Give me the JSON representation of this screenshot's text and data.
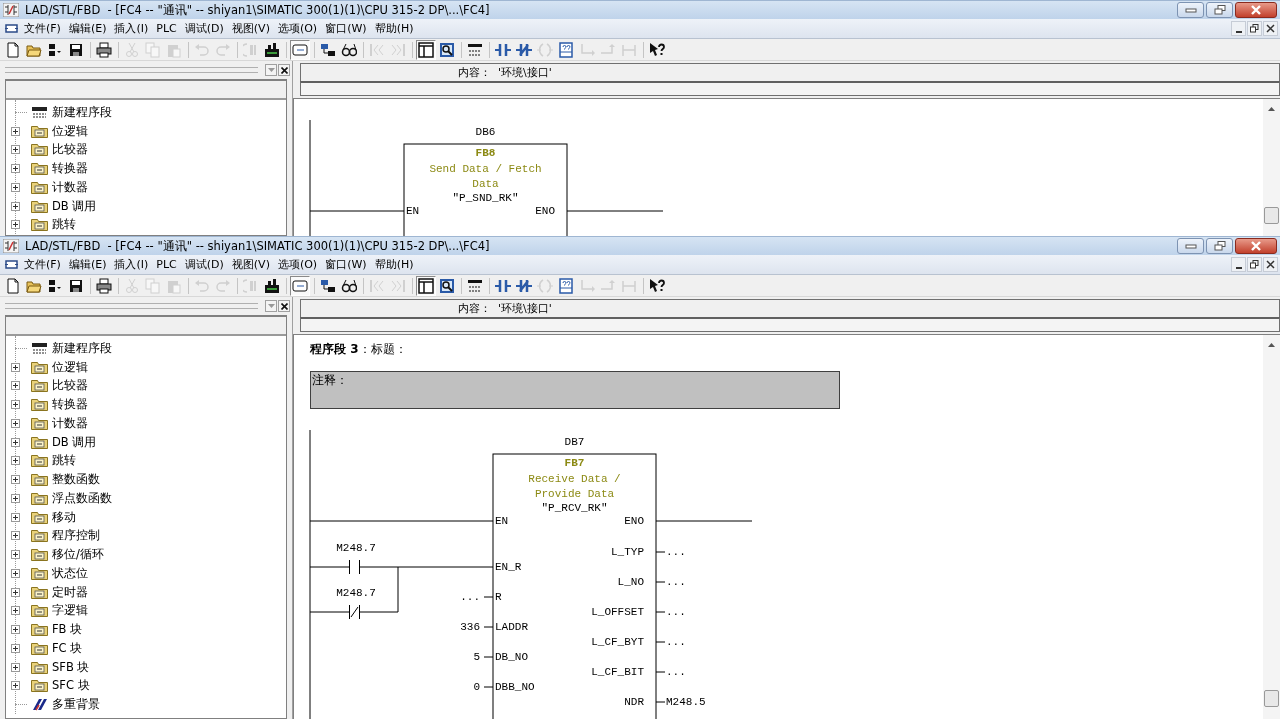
{
  "windows": [
    {
      "title": "LAD/STL/FBD  - [FC4 -- \"通讯\" -- shiyan1\\SIMATIC 300(1)(1)\\CPU 315-2 DP\\...\\FC4]",
      "menu": [
        "文件(F)",
        "编辑(E)",
        "插入(I)",
        "PLC",
        "调试(D)",
        "视图(V)",
        "选项(O)",
        "窗口(W)",
        "帮助(H)"
      ],
      "toolbar": [
        [
          {
            "kind": "new",
            "disabled": false,
            "pressed": false
          },
          {
            "kind": "open",
            "disabled": false,
            "pressed": false
          },
          {
            "kind": "nodes",
            "disabled": false,
            "pressed": false
          },
          {
            "kind": "save",
            "disabled": false,
            "pressed": false
          }
        ],
        [
          {
            "kind": "print",
            "disabled": false,
            "pressed": false
          }
        ],
        [
          {
            "kind": "cut",
            "disabled": true,
            "pressed": false
          },
          {
            "kind": "copy",
            "disabled": true,
            "pressed": false
          },
          {
            "kind": "paste",
            "disabled": true,
            "pressed": false
          }
        ],
        [
          {
            "kind": "undo",
            "disabled": true,
            "pressed": false
          },
          {
            "kind": "redo",
            "disabled": true,
            "pressed": false
          }
        ],
        [
          {
            "kind": "download",
            "disabled": true,
            "pressed": false
          },
          {
            "kind": "module",
            "disabled": false,
            "pressed": false
          }
        ],
        [
          {
            "kind": "window",
            "disabled": false,
            "pressed": true
          }
        ],
        [
          {
            "kind": "network",
            "disabled": false,
            "pressed": false
          },
          {
            "kind": "glasses",
            "disabled": false,
            "pressed": false
          }
        ],
        [
          {
            "kind": "prev",
            "disabled": true,
            "pressed": false
          },
          {
            "kind": "next",
            "disabled": true,
            "pressed": false
          }
        ],
        [
          {
            "kind": "panel",
            "disabled": false,
            "pressed": true
          },
          {
            "kind": "zoom",
            "disabled": false,
            "pressed": false
          }
        ],
        [
          {
            "kind": "newnetwork",
            "disabled": false,
            "pressed": false
          }
        ],
        [
          {
            "kind": "nocontact",
            "disabled": false,
            "pressed": false
          },
          {
            "kind": "nccontact",
            "disabled": false,
            "pressed": false
          },
          {
            "kind": "coil",
            "disabled": true,
            "pressed": false
          },
          {
            "kind": "box",
            "disabled": false,
            "pressed": false
          },
          {
            "kind": "branchopen",
            "disabled": true,
            "pressed": false
          },
          {
            "kind": "branchclose",
            "disabled": true,
            "pressed": false
          },
          {
            "kind": "connector",
            "disabled": true,
            "pressed": false
          }
        ],
        [
          {
            "kind": "help",
            "disabled": false,
            "pressed": false
          }
        ]
      ],
      "tree": [
        {
          "label": "新建程序段",
          "kind": "network"
        },
        {
          "label": "位逻辑",
          "kind": "folder",
          "expanded": false
        },
        {
          "label": "比较器",
          "kind": "folder",
          "expanded": false
        },
        {
          "label": "转换器",
          "kind": "folder",
          "expanded": false
        },
        {
          "label": "计数器",
          "kind": "folder",
          "expanded": false
        },
        {
          "label": "DB 调用",
          "kind": "folder",
          "expanded": false
        },
        {
          "label": "跳转",
          "kind": "folder",
          "expanded": false
        }
      ],
      "content_label": "内容：  '环境\\接口'",
      "network": {
        "instance": "DB6",
        "number": "FB8",
        "description": [
          "Send Data / Fetch",
          "Data"
        ],
        "symbol": "\"P_SND_RK\"",
        "inputs": [
          {
            "pin": "EN",
            "kind": "rail"
          }
        ],
        "outputs": [
          {
            "pin": "ENO",
            "kind": "wire"
          }
        ]
      }
    },
    {
      "title": "LAD/STL/FBD  - [FC4 -- \"通讯\" -- shiyan1\\SIMATIC 300(1)(1)\\CPU 315-2 DP\\...\\FC4]",
      "menu": [
        "文件(F)",
        "编辑(E)",
        "插入(I)",
        "PLC",
        "调试(D)",
        "视图(V)",
        "选项(O)",
        "窗口(W)",
        "帮助(H)"
      ],
      "toolbar": [
        [
          {
            "kind": "new",
            "disabled": false,
            "pressed": false
          },
          {
            "kind": "open",
            "disabled": false,
            "pressed": false
          },
          {
            "kind": "nodes",
            "disabled": false,
            "pressed": false
          },
          {
            "kind": "save",
            "disabled": false,
            "pressed": false
          }
        ],
        [
          {
            "kind": "print",
            "disabled": false,
            "pressed": false
          }
        ],
        [
          {
            "kind": "cut",
            "disabled": true,
            "pressed": false
          },
          {
            "kind": "copy",
            "disabled": true,
            "pressed": false
          },
          {
            "kind": "paste",
            "disabled": true,
            "pressed": false
          }
        ],
        [
          {
            "kind": "undo",
            "disabled": true,
            "pressed": false
          },
          {
            "kind": "redo",
            "disabled": true,
            "pressed": false
          }
        ],
        [
          {
            "kind": "download",
            "disabled": true,
            "pressed": false
          },
          {
            "kind": "module",
            "disabled": false,
            "pressed": false
          }
        ],
        [
          {
            "kind": "window",
            "disabled": false,
            "pressed": true
          }
        ],
        [
          {
            "kind": "network",
            "disabled": false,
            "pressed": false
          },
          {
            "kind": "glasses",
            "disabled": false,
            "pressed": false
          }
        ],
        [
          {
            "kind": "prev",
            "disabled": true,
            "pressed": false
          },
          {
            "kind": "next",
            "disabled": true,
            "pressed": false
          }
        ],
        [
          {
            "kind": "panel",
            "disabled": false,
            "pressed": true
          },
          {
            "kind": "zoom",
            "disabled": false,
            "pressed": false
          }
        ],
        [
          {
            "kind": "newnetwork",
            "disabled": false,
            "pressed": false
          }
        ],
        [
          {
            "kind": "nocontact",
            "disabled": false,
            "pressed": false
          },
          {
            "kind": "nccontact",
            "disabled": false,
            "pressed": false
          },
          {
            "kind": "coil",
            "disabled": true,
            "pressed": false
          },
          {
            "kind": "box",
            "disabled": false,
            "pressed": false
          },
          {
            "kind": "branchopen",
            "disabled": true,
            "pressed": false
          },
          {
            "kind": "branchclose",
            "disabled": true,
            "pressed": false
          },
          {
            "kind": "connector",
            "disabled": true,
            "pressed": false
          }
        ],
        [
          {
            "kind": "help",
            "disabled": false,
            "pressed": false
          }
        ]
      ],
      "tree": [
        {
          "label": "新建程序段",
          "kind": "network"
        },
        {
          "label": "位逻辑",
          "kind": "folder",
          "expanded": false
        },
        {
          "label": "比较器",
          "kind": "folder",
          "expanded": false
        },
        {
          "label": "转换器",
          "kind": "folder",
          "expanded": false
        },
        {
          "label": "计数器",
          "kind": "folder",
          "expanded": false
        },
        {
          "label": "DB 调用",
          "kind": "folder",
          "expanded": false
        },
        {
          "label": "跳转",
          "kind": "folder",
          "expanded": false
        },
        {
          "label": "整数函数",
          "kind": "folder",
          "expanded": false
        },
        {
          "label": "浮点数函数",
          "kind": "folder",
          "expanded": false
        },
        {
          "label": "移动",
          "kind": "folder",
          "expanded": false
        },
        {
          "label": "程序控制",
          "kind": "folder",
          "expanded": false
        },
        {
          "label": "移位/循环",
          "kind": "folder",
          "expanded": false
        },
        {
          "label": "状态位",
          "kind": "folder",
          "expanded": false
        },
        {
          "label": "定时器",
          "kind": "folder",
          "expanded": false
        },
        {
          "label": "字逻辑",
          "kind": "folder",
          "expanded": false
        },
        {
          "label": "FB 块",
          "kind": "folder",
          "expanded": false
        },
        {
          "label": "FC 块",
          "kind": "folder",
          "expanded": false
        },
        {
          "label": "SFB 块",
          "kind": "folder",
          "expanded": false
        },
        {
          "label": "SFC 块",
          "kind": "folder",
          "expanded": false
        },
        {
          "label": "多重背景",
          "kind": "instance"
        }
      ],
      "content_label": "内容：  '环境\\接口'",
      "network": {
        "title": "**程序段 3**：标题：",
        "comment": "注释：",
        "instance": "DB7",
        "number": "FB7",
        "description": [
          "Receive Data /",
          "Provide Data"
        ],
        "symbol": "\"P_RCV_RK\"",
        "inputs": [
          {
            "pin": "EN",
            "kind": "rail"
          },
          {
            "pin": "EN_R",
            "kind": "contacts",
            "contacts": [
              {
                "address": "M248.7",
                "kind": "no"
              },
              {
                "address": "M248.7",
                "kind": "nc"
              }
            ]
          },
          {
            "pin": "R",
            "kind": "value",
            "value": "..."
          },
          {
            "pin": "LADDR",
            "kind": "value",
            "value": "336"
          },
          {
            "pin": "DB_NO",
            "kind": "value",
            "value": "5"
          },
          {
            "pin": "DBB_NO",
            "kind": "value",
            "value": "0"
          }
        ],
        "outputs": [
          {
            "pin": "ENO",
            "kind": "wire"
          },
          {
            "pin": "L_TYP",
            "kind": "value",
            "value": "..."
          },
          {
            "pin": "L_NO",
            "kind": "value",
            "value": "..."
          },
          {
            "pin": "L_OFFSET",
            "kind": "value",
            "value": "..."
          },
          {
            "pin": "L_CF_BYT",
            "kind": "value",
            "value": "..."
          },
          {
            "pin": "L_CF_BIT",
            "kind": "value",
            "value": "..."
          },
          {
            "pin": "NDR",
            "kind": "value",
            "value": "M248.5"
          }
        ]
      }
    }
  ]
}
